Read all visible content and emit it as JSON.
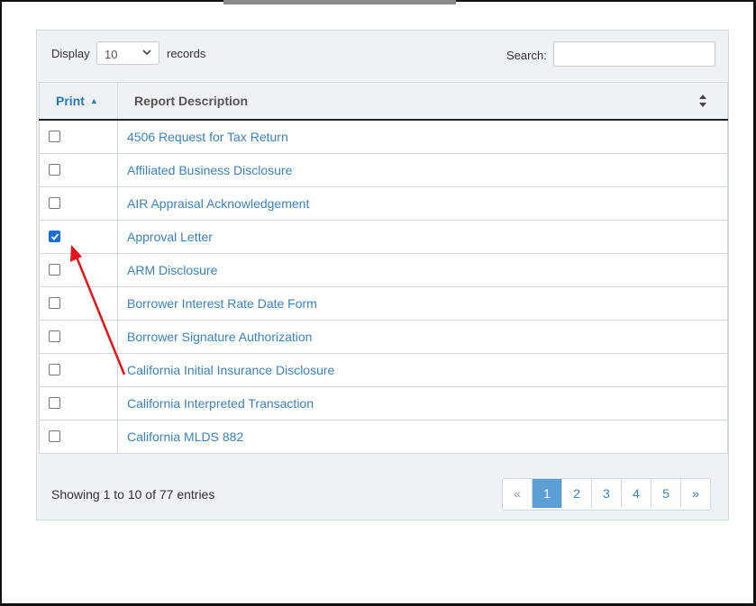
{
  "toolbar": {
    "display_label": "Display",
    "display_value": "10",
    "records_label": "records",
    "search_label": "Search:",
    "search_value": ""
  },
  "table": {
    "columns": [
      "Print",
      "Report Description"
    ],
    "rows": [
      {
        "label": "4506 Request for Tax Return",
        "checked": false
      },
      {
        "label": "Affiliated Business Disclosure",
        "checked": false
      },
      {
        "label": "AIR Appraisal Acknowledgement",
        "checked": false
      },
      {
        "label": "Approval Letter",
        "checked": true
      },
      {
        "label": "ARM Disclosure",
        "checked": false
      },
      {
        "label": "Borrower Interest Rate Date Form",
        "checked": false
      },
      {
        "label": "Borrower Signature Authorization",
        "checked": false
      },
      {
        "label": "California Initial Insurance Disclosure",
        "checked": false
      },
      {
        "label": "California Interpreted Transaction",
        "checked": false
      },
      {
        "label": "California MLDS 882",
        "checked": false
      }
    ]
  },
  "footer": {
    "showing": "Showing 1 to 10 of 77 entries",
    "pagination": [
      "«",
      "1",
      "2",
      "3",
      "4",
      "5",
      "»"
    ],
    "active_page": "1"
  },
  "colors": {
    "accent": "#3a82c0",
    "checkbox_checked": "#1a6fd1",
    "annotation_arrow": "#e8141c"
  }
}
